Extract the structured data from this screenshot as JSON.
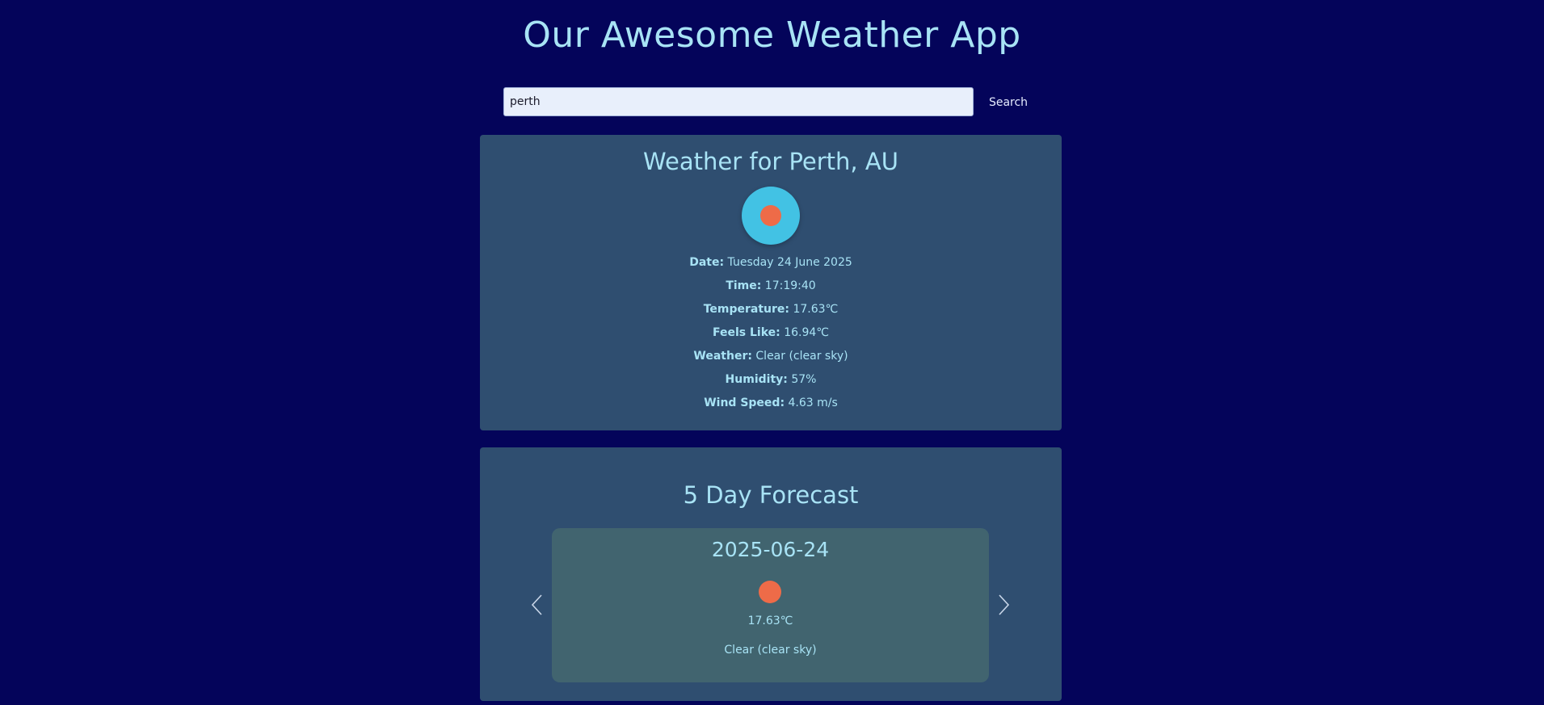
{
  "header": {
    "title": "Our Awesome Weather App"
  },
  "search": {
    "value": "perth",
    "button_label": "Search"
  },
  "current": {
    "title": "Weather for Perth, AU",
    "icon": "clear-sky-sun-icon",
    "details": [
      {
        "label": "Date:",
        "value": "Tuesday 24 June 2025"
      },
      {
        "label": "Time:",
        "value": "17:19:40"
      },
      {
        "label": "Temperature:",
        "value": "17.63℃"
      },
      {
        "label": "Feels Like:",
        "value": "16.94℃"
      },
      {
        "label": "Weather:",
        "value": "Clear (clear sky)"
      },
      {
        "label": "Humidity:",
        "value": "57%"
      },
      {
        "label": "Wind Speed:",
        "value": "4.63 m/s"
      }
    ]
  },
  "forecast": {
    "title": "5 Day Forecast",
    "prev_icon": "chevron-left-icon",
    "next_icon": "chevron-right-icon",
    "cards": [
      {
        "date": "2025-06-24",
        "icon": "clear-sky-sun-icon",
        "temperature": "17.63℃",
        "description": "Clear (clear sky)"
      }
    ]
  },
  "colors": {
    "background": "#04045a",
    "panel": "#2f4e70",
    "card": "#41646f",
    "text": "#a8e3f5",
    "icon_circle": "#42c2e4",
    "sun": "#ee6b48"
  }
}
